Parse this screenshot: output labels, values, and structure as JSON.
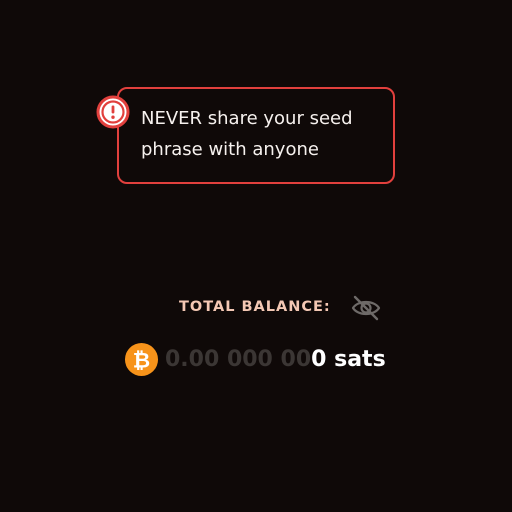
{
  "warning": {
    "line1": "NEVER share your seed",
    "line2": "phrase with anyone",
    "icon": "exclamation-circle-icon",
    "accent_color": "#e1403d"
  },
  "balance": {
    "label": "TOTAL BALANCE:",
    "visibility_icon": "eye-off-icon",
    "currency_icon": "bitcoin-icon",
    "amount_dim": "0.00 000 00",
    "amount_bright": "0 sats",
    "label_color": "#f4c8b4",
    "bitcoin_color": "#f7931a"
  }
}
